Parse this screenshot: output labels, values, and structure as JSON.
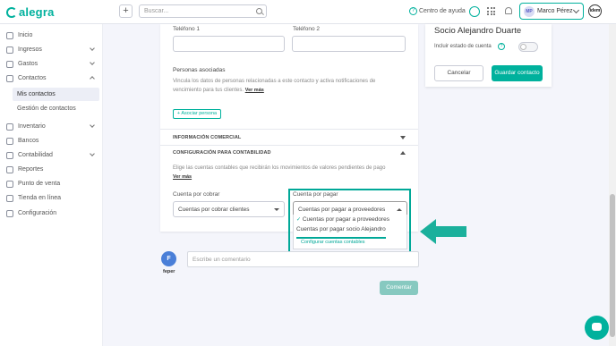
{
  "app": {
    "logo_text": "alegra"
  },
  "topbar": {
    "plus_label": "+",
    "search_placeholder": "Buscar...",
    "help_label": "Centro de ayuda",
    "help_icon_glyph": "?",
    "user_initials": "MP",
    "user_name": "Marco Pérez",
    "company_logo_text": "idem"
  },
  "sidebar": {
    "items": [
      {
        "label": "Inicio",
        "icon": "home-icon"
      },
      {
        "label": "Ingresos",
        "icon": "income-icon"
      },
      {
        "label": "Gastos",
        "icon": "expenses-icon"
      },
      {
        "label": "Contactos",
        "icon": "contacts-icon"
      },
      {
        "label": "Mis contactos"
      },
      {
        "label": "Gestión de contactos"
      },
      {
        "label": "Inventario",
        "icon": "inventory-icon"
      },
      {
        "label": "Bancos",
        "icon": "bank-icon"
      },
      {
        "label": "Contabilidad",
        "icon": "accounting-icon"
      },
      {
        "label": "Reportes",
        "icon": "reports-icon"
      },
      {
        "label": "Punto de venta",
        "icon": "pos-icon"
      },
      {
        "label": "Tienda en línea",
        "icon": "store-icon"
      },
      {
        "label": "Configuración",
        "icon": "settings-icon"
      }
    ]
  },
  "form": {
    "phone1_label": "Teléfono 1",
    "phone2_label": "Teléfono 2",
    "associated_title": "Personas asociadas",
    "associated_desc": "Vincula los datos de personas relacionadas a este contacto y activa notificaciones de vencimiento para tus clientes.",
    "see_more": "Ver más",
    "associate_button": "+ Asociar persona",
    "commercial_section": "INFORMACIÓN COMERCIAL",
    "accounting_section": "CONFIGURACIÓN PARA CONTABILIDAD",
    "accounting_desc": "Elige las cuentas contables que recibirán los movimientos de valores pendientes de pago",
    "receivable_label": "Cuenta por cobrar",
    "receivable_value": "Cuentas por cobrar clientes",
    "payable_label": "Cuenta por pagar",
    "payable_value": "Cuentas por pagar a proveedores",
    "dropdown": {
      "option1": "Cuentas por pagar a proveedores",
      "check_glyph": "✓",
      "option2": "Cuentas por pagar socio Alejandro",
      "config_link": "Configurar cuentas contables"
    }
  },
  "right_panel": {
    "title": "Socio Alejandro Duarte",
    "account_status_label": "Incluir estado de cuenta",
    "help_glyph": "?",
    "cancel_label": "Cancelar",
    "save_label": "Guardar contacto"
  },
  "comment": {
    "avatar_initial": "F",
    "user": "feper",
    "placeholder": "Escribe un comentario",
    "button": "Comentar"
  },
  "colors": {
    "accent": "#00b19d",
    "highlight": "#00a898"
  }
}
